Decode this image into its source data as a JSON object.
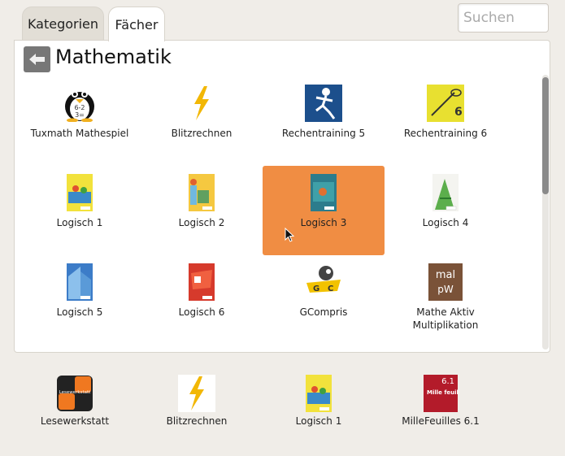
{
  "tabs": [
    {
      "label": "Kategorien"
    },
    {
      "label": "Fächer"
    }
  ],
  "search": {
    "placeholder": "Suchen",
    "value": ""
  },
  "header": {
    "title": "Mathematik"
  },
  "grid": [
    {
      "label": "Tuxmath Mathespiel",
      "icon": "tuxmath-icon"
    },
    {
      "label": "Blitzrechnen",
      "icon": "lightning-icon"
    },
    {
      "label": "Rechentraining 5",
      "icon": "rechentraining5-icon"
    },
    {
      "label": "Rechentraining 6",
      "icon": "rechentraining6-icon"
    },
    {
      "label": "Logisch 1",
      "icon": "book-icon"
    },
    {
      "label": "Logisch 2",
      "icon": "book-icon"
    },
    {
      "label": "Logisch 3",
      "icon": "book-icon",
      "selected": true
    },
    {
      "label": "Logisch 4",
      "icon": "book-icon"
    },
    {
      "label": "Logisch 5",
      "icon": "book-icon"
    },
    {
      "label": "Logisch 6",
      "icon": "book-icon"
    },
    {
      "label": "GCompris",
      "icon": "gcompris-icon"
    },
    {
      "label": "Mathe Aktiv Multiplikation",
      "icon": "mathe-aktiv-icon",
      "icon_text": "mal",
      "icon_text2": "pW"
    }
  ],
  "favorites": [
    {
      "label": "Lesewerkstatt",
      "icon": "lesewerkstatt-icon",
      "icon_text": "Lesewerkstatt"
    },
    {
      "label": "Blitzrechnen",
      "icon": "lightning-icon"
    },
    {
      "label": "Logisch 1",
      "icon": "book-icon"
    },
    {
      "label": "MilleFeuilles 6.1",
      "icon": "millefeuilles-icon",
      "icon_text": "6.1",
      "icon_text2": "Mille feuilles"
    }
  ],
  "colors": {
    "selected": "#f08d43",
    "tab_active": "#ffffff",
    "tab_inactive": "#e2ded6"
  }
}
